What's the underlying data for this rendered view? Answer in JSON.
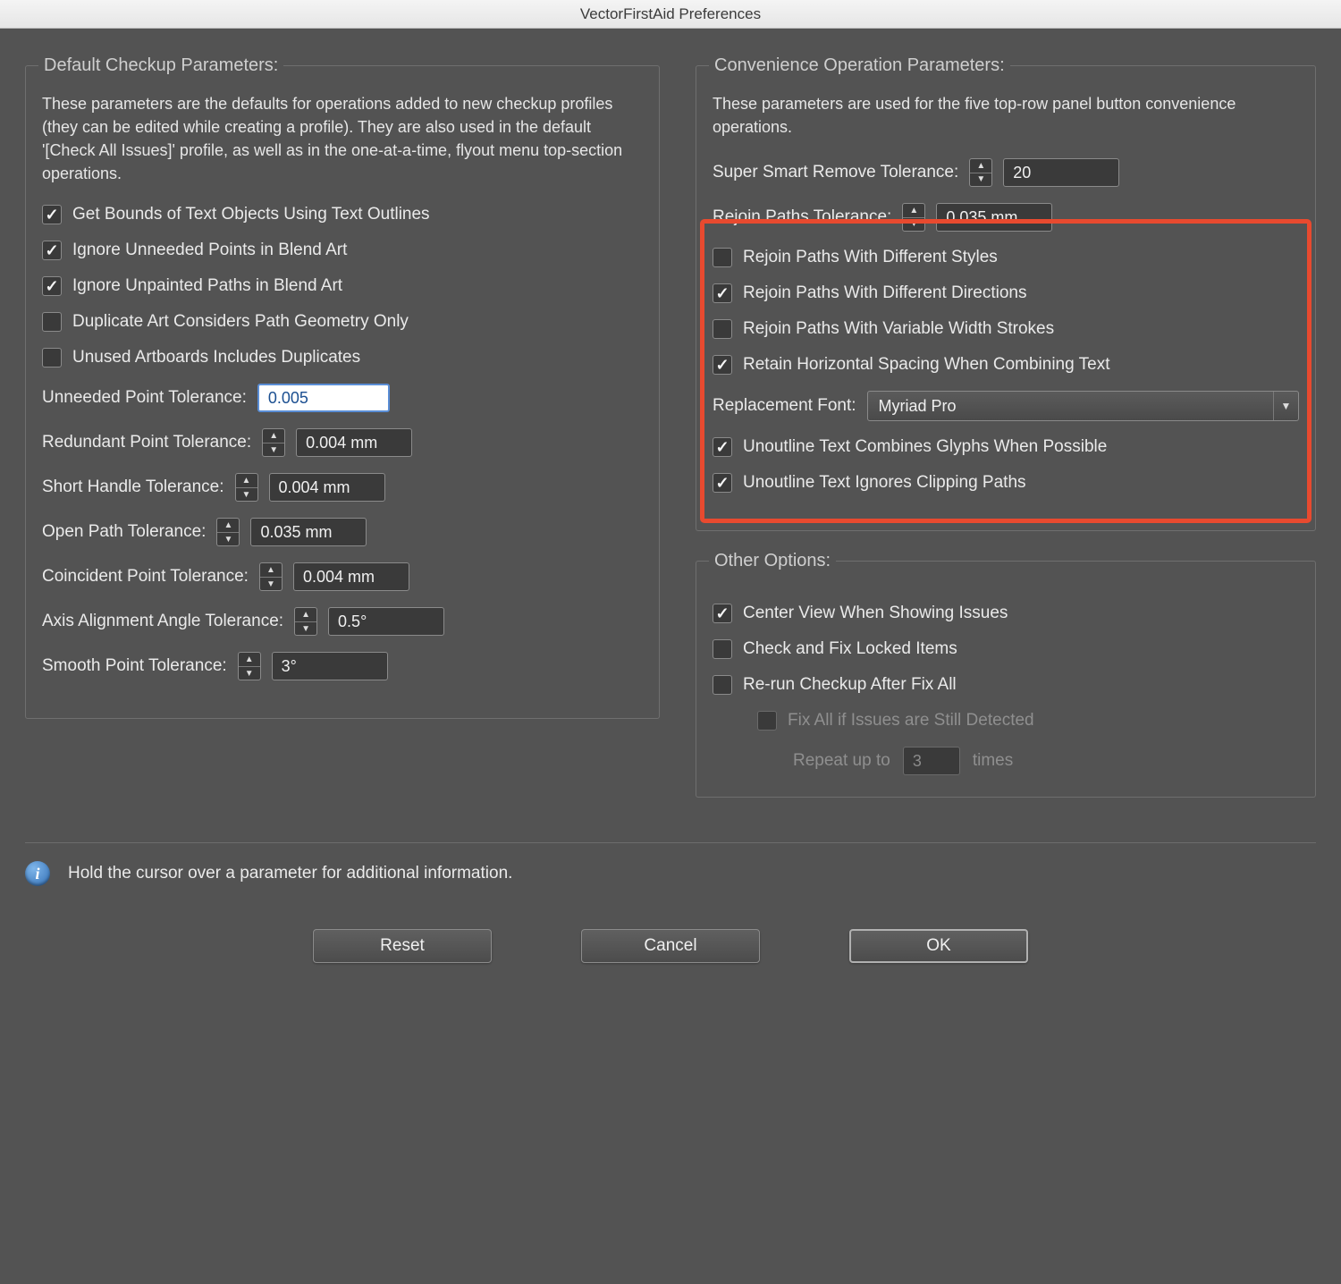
{
  "window": {
    "title": "VectorFirstAid Preferences"
  },
  "default_group": {
    "legend": "Default Checkup Parameters:",
    "desc": "These parameters are the defaults for operations added to new checkup profiles (they can be edited while creating a profile). They are also used in the default '[Check All Issues]' profile, as well as in the one-at-a-time, flyout menu top-section operations.",
    "cb_text_outlines": "Get Bounds of Text Objects Using Text Outlines",
    "cb_ignore_points_blend": "Ignore Unneeded Points in Blend Art",
    "cb_ignore_unpainted_blend": "Ignore Unpainted Paths in Blend Art",
    "cb_dup_geometry": "Duplicate Art Considers Path Geometry Only",
    "cb_unused_artboards": "Unused Artboards Includes Duplicates",
    "unneeded_point_label": "Unneeded Point Tolerance:",
    "unneeded_point_value": "0.005",
    "redundant_point_label": "Redundant Point Tolerance:",
    "redundant_point_value": "0.004 mm",
    "short_handle_label": "Short Handle Tolerance:",
    "short_handle_value": "0.004 mm",
    "open_path_label": "Open Path Tolerance:",
    "open_path_value": "0.035 mm",
    "coincident_label": "Coincident Point Tolerance:",
    "coincident_value": "0.004 mm",
    "axis_label": "Axis Alignment Angle Tolerance:",
    "axis_value": "0.5°",
    "smooth_label": "Smooth Point Tolerance:",
    "smooth_value": "3°"
  },
  "conv_group": {
    "legend": "Convenience Operation Parameters:",
    "desc": "These parameters are used for the five top-row panel button convenience operations.",
    "super_smart_label": "Super Smart Remove Tolerance:",
    "super_smart_value": "20",
    "rejoin_tol_label": "Rejoin Paths Tolerance:",
    "rejoin_tol_value": "0.035 mm",
    "cb_rejoin_styles": "Rejoin Paths With Different Styles",
    "cb_rejoin_dirs": "Rejoin Paths With Different Directions",
    "cb_rejoin_varwidth": "Rejoin Paths With Variable Width Strokes",
    "cb_retain_hspace": "Retain Horizontal Spacing When Combining Text",
    "replacement_font_label": "Replacement Font:",
    "replacement_font_value": "Myriad Pro",
    "cb_unoutline_combine": "Unoutline Text Combines Glyphs When Possible",
    "cb_unoutline_clip": "Unoutline Text Ignores Clipping Paths"
  },
  "other_group": {
    "legend": "Other Options:",
    "cb_center_view": "Center View When Showing Issues",
    "cb_check_locked": "Check and Fix Locked Items",
    "cb_rerun": "Re-run Checkup After Fix All",
    "cb_fixall_still": "Fix All if Issues are Still Detected",
    "repeat_label_pre": "Repeat up to",
    "repeat_value": "3",
    "repeat_label_post": "times"
  },
  "hint": "Hold the cursor over a parameter for additional information.",
  "buttons": {
    "reset": "Reset",
    "cancel": "Cancel",
    "ok": "OK"
  }
}
